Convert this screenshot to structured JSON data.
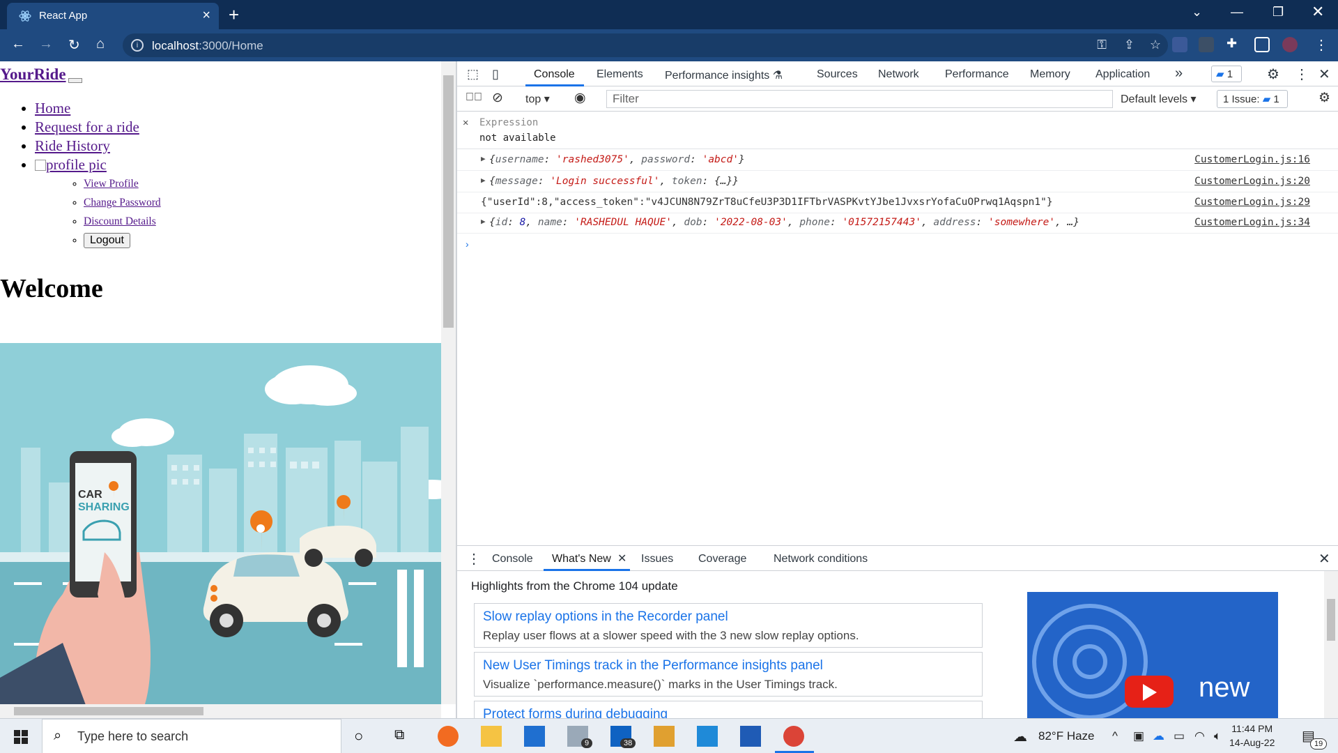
{
  "browser": {
    "tab_title": "React App",
    "url_host": "localhost",
    "url_rest": ":3000/Home"
  },
  "page": {
    "brand": "YourRide",
    "nav": {
      "home": "Home",
      "request": "Request for a ride",
      "history": "Ride History",
      "profile_alt": "profile pic"
    },
    "profile_menu": {
      "view": "View Profile",
      "change_password": "Change Password",
      "discount": "Discount Details",
      "logout": "Logout"
    },
    "welcome": "Welcome",
    "hero": {
      "line1": "CAR",
      "line2": "SHARING"
    }
  },
  "devtools": {
    "tabs": {
      "console": "Console",
      "elements": "Elements",
      "perf_insights": "Performance insights",
      "sources": "Sources",
      "network": "Network",
      "performance": "Performance",
      "memory": "Memory",
      "application": "Application",
      "more": "»"
    },
    "message_count": "1",
    "toolbar": {
      "context": "top",
      "filter_placeholder": "Filter",
      "levels": "Default levels",
      "issues_label": "1 Issue:",
      "issues_count": "1"
    },
    "expression": {
      "label": "Expression",
      "value": "not available"
    },
    "logs": [
      {
        "src": "CustomerLogin.js:16",
        "parts": [
          "{",
          "username",
          ": ",
          "'rashed3075'",
          ", ",
          "password",
          ": ",
          "'abcd'",
          "}"
        ]
      },
      {
        "src": "CustomerLogin.js:20",
        "parts": [
          "{",
          "message",
          ": ",
          "'Login successful'",
          ", ",
          "token",
          ": ",
          "{…}}"
        ]
      },
      {
        "src": "CustomerLogin.js:29",
        "text": "{\"userId\":8,\"access_token\":\"v4JCUN8N79ZrT8uCfeU3P3D1IFTbrVASPKvtYJbe1JvxsrYofaCuOPrwq1Aqspn1\"}"
      },
      {
        "src": "CustomerLogin.js:34",
        "parts": [
          "{",
          "id",
          ": ",
          "8",
          ", ",
          "name",
          ": ",
          "'RASHEDUL HAQUE'",
          ", ",
          "dob",
          ": ",
          "'2022-08-03'",
          ", ",
          "phone",
          ": ",
          "'01572157443'",
          ", ",
          "address",
          ": ",
          "'somewhere'",
          ", …}"
        ]
      }
    ],
    "drawer": {
      "tabs": {
        "console": "Console",
        "whats_new": "What's New",
        "issues": "Issues",
        "coverage": "Coverage",
        "network_conditions": "Network conditions"
      },
      "highlights": "Highlights from the Chrome 104 update",
      "cards": [
        {
          "title": "Slow replay options in the Recorder panel",
          "desc": "Replay user flows at a slower speed with the 3 new slow replay options."
        },
        {
          "title": "New User Timings track in the Performance insights panel",
          "desc": "Visualize `performance.measure()` marks in the User Timings track."
        },
        {
          "title": "Protect forms during debugging",
          "desc": ""
        }
      ],
      "promo_text": "new"
    }
  },
  "taskbar": {
    "search_placeholder": "Type here to search",
    "mail_badge": "9",
    "outlook_badge": "38",
    "weather": "82°F  Haze",
    "time": "11:44 PM",
    "date": "14-Aug-22",
    "notif_count": "19"
  }
}
